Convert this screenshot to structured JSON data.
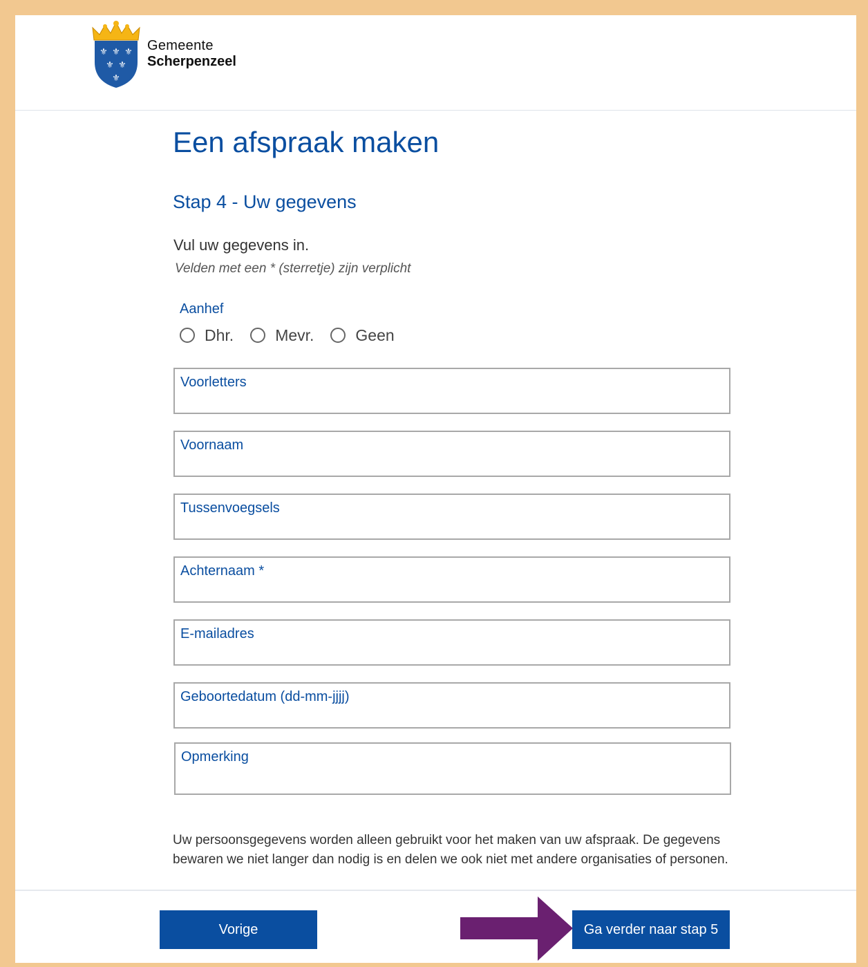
{
  "header": {
    "logo_line1": "Gemeente",
    "logo_line2": "Scherpenzeel",
    "logo_icon": "municipality-coat-of-arms"
  },
  "page": {
    "title": "Een afspraak maken",
    "step_title": "Stap 4 - Uw gegevens",
    "intro": "Vul uw gegevens in.",
    "required_note": "Velden met een * (sterretje) zijn verplicht"
  },
  "salutation": {
    "label": "Aanhef",
    "options": [
      "Dhr.",
      "Mevr.",
      "Geen"
    ]
  },
  "fields": {
    "initials": "Voorletters",
    "first_name": "Voornaam",
    "prefixes": "Tussenvoegsels",
    "last_name": "Achternaam *",
    "email": "E-mailadres",
    "birthdate": "Geboortedatum (dd-mm-jjjj)",
    "remark": "Opmerking"
  },
  "privacy_text": "Uw persoonsgegevens worden alleen gebruikt voor het maken van uw afspraak. De gegevens bewaren we niet langer dan nodig is en delen we ook niet met andere organisaties of personen.",
  "buttons": {
    "previous": "Vorige",
    "next": "Ga verder naar stap 5"
  },
  "colors": {
    "brand_blue": "#0a4ea0",
    "outer_frame": "#f2c890",
    "annotation_arrow": "#6a2070"
  }
}
